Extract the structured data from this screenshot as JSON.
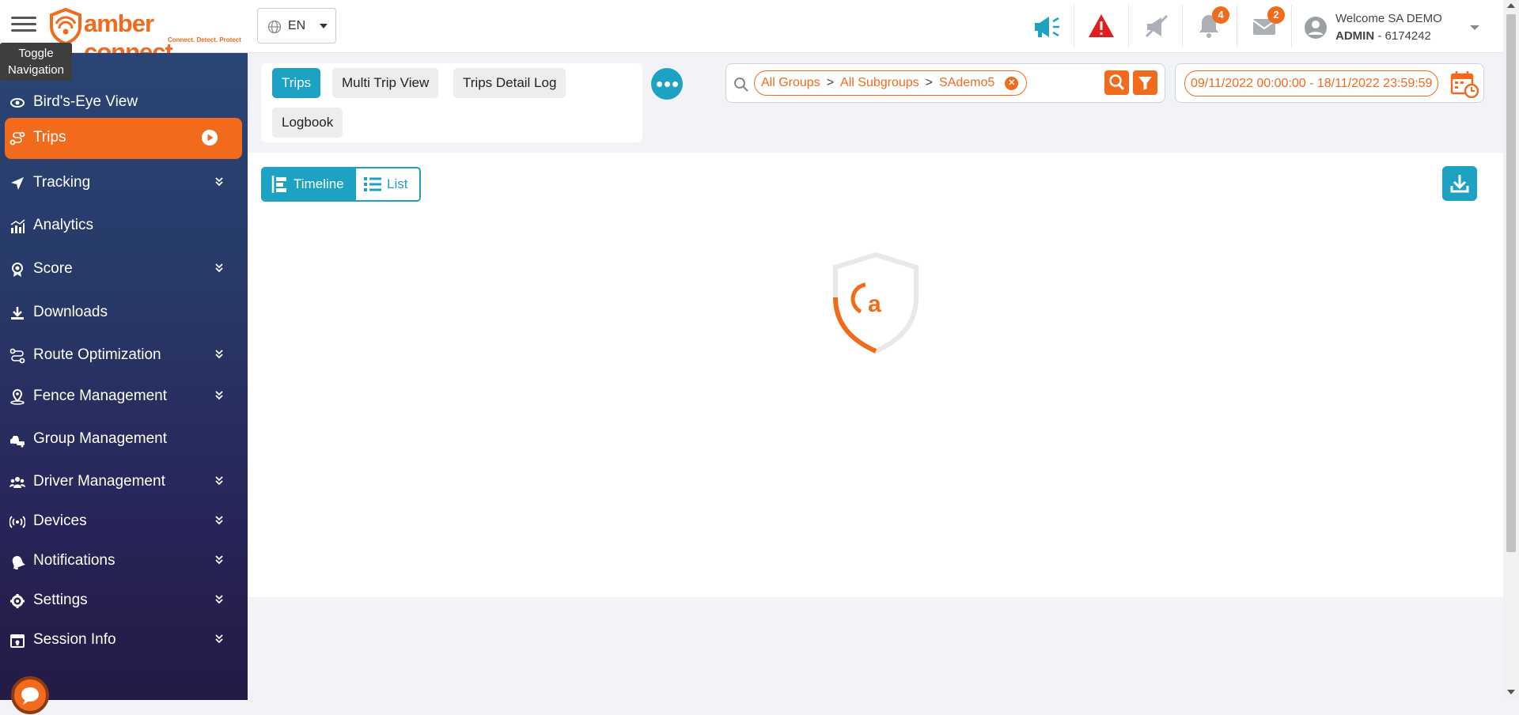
{
  "app": {
    "brand": "amber connect",
    "tagline": "Connect. Detect. Protect",
    "accent": "#f26a1b",
    "secondary": "#1da2c4"
  },
  "header": {
    "toggle_tooltip": "Toggle Navigation",
    "language": "EN",
    "notifications_count": "4",
    "messages_count": "2",
    "welcome": "Welcome SA DEMO",
    "role": "ADMIN",
    "account_id": "- 6174242"
  },
  "sidebar": {
    "items": [
      {
        "label": "Bird's-Eye View",
        "icon": "eye-icon"
      },
      {
        "label": "Trips",
        "icon": "route-icon",
        "active": true
      },
      {
        "label": "Tracking",
        "icon": "location-arrow-icon"
      },
      {
        "label": "Analytics",
        "icon": "bar-chart-icon"
      },
      {
        "label": "Score",
        "icon": "award-icon"
      },
      {
        "label": "Downloads",
        "icon": "download-icon"
      },
      {
        "label": "Route Optimization",
        "icon": "route-optimization-icon"
      },
      {
        "label": "Fence Management",
        "icon": "geofence-pin-icon"
      },
      {
        "label": "Group Management",
        "icon": "vehicles-group-icon"
      },
      {
        "label": "Driver Management",
        "icon": "users-icon"
      },
      {
        "label": "Devices",
        "icon": "broadcast-icon"
      },
      {
        "label": "Notifications",
        "icon": "bell-icon"
      },
      {
        "label": "Settings",
        "icon": "gear-icon"
      },
      {
        "label": "Session Info",
        "icon": "session-icon"
      }
    ]
  },
  "toolbar": {
    "tabs": [
      "Trips",
      "Multi Trip View",
      "Trips Detail Log",
      "Logbook"
    ],
    "filter": {
      "group": "All Groups",
      "subgroup": "All Subgroups",
      "device": "SAdemo5",
      "separator": ">"
    },
    "date_range": "09/11/2022 00:00:00 - 18/11/2022 23:59:59"
  },
  "view_toggle": {
    "timeline": "Timeline",
    "list": "List"
  }
}
